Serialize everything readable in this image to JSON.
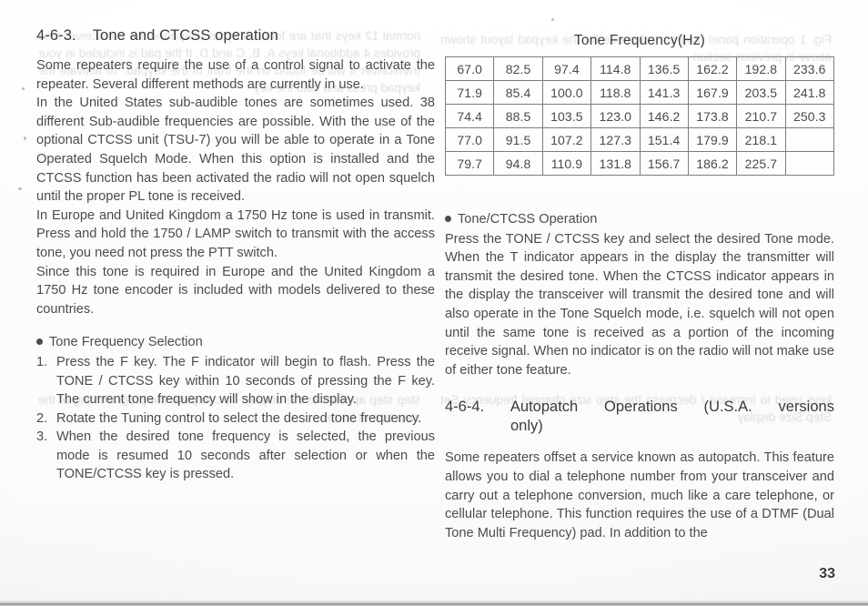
{
  "page": {
    "number": "33"
  },
  "left_column": {
    "heading": {
      "number": "4-6-3.",
      "title": "Tone and CTCSS operation"
    },
    "paragraphs": [
      "Some repeaters require the use of a control signal to activate the repeater. Several different methods are currently in use.",
      "In the United States sub-audible tones are sometimes used. 38 different Sub-audible frequencies are possible. With the use of the optional CTCSS unit (TSU-7) you will be able to operate in a Tone Operated Squelch Mode. When this option is installed and the CTCSS function has been activated the radio will not open squelch until the proper PL tone is received.",
      "In Europe and United Kingdom a 1750 Hz tone is used in transmit. Press and hold the 1750 / LAMP switch to transmit with the access tone, you need not press the PTT switch.",
      "Since this tone is required in Europe and the United Kingdom a 1750 Hz tone encoder is included with models delivered to these countries."
    ],
    "bullet_heading": "Tone Frequency Selection",
    "steps": [
      {
        "marker": "1.",
        "text": "Press the F key. The F indicator will begin to flash. Press the TONE / CTCSS key within 10 seconds of pressing the F key. The current tone frequency will show in the display."
      },
      {
        "marker": "2.",
        "text": "Rotate the Tuning control to select the desired tone frequency."
      },
      {
        "marker": "3.",
        "text": "When the desired tone frequency is selected, the previous mode is resumed 10 seconds after selection or when the TONE/CTCSS key is pressed."
      }
    ]
  },
  "right_column": {
    "table": {
      "title": "Tone Frequency(Hz)",
      "rows": [
        [
          "67.0",
          "82.5",
          "97.4",
          "114.8",
          "136.5",
          "162.2",
          "192.8",
          "233.6"
        ],
        [
          "71.9",
          "85.4",
          "100.0",
          "118.8",
          "141.3",
          "167.9",
          "203.5",
          "241.8"
        ],
        [
          "74.4",
          "88.5",
          "103.5",
          "123.0",
          "146.2",
          "173.8",
          "210.7",
          "250.3"
        ],
        [
          "77.0",
          "91.5",
          "107.2",
          "127.3",
          "151.4",
          "179.9",
          "218.1",
          ""
        ],
        [
          "79.7",
          "94.8",
          "110.9",
          "131.8",
          "156.7",
          "186.2",
          "225.7",
          ""
        ]
      ]
    },
    "bullet_heading": "Tone/CTCSS Operation",
    "paragraph_1": "Press the TONE / CTCSS key and select the desired Tone mode. When the T indicator appears in the display the transmitter will transmit the desired tone. When the CTCSS indicator appears in the display the transceiver will transmit the desired tone and will also operate in the Tone Squelch mode, i.e. squelch will not open until the same tone is received as a portion of the incoming receive signal. When no indicator is on the radio will not make use of either tone feature.",
    "heading_2": {
      "number": "4-6-4.",
      "word_1": "Autopatch",
      "word_2": "Operations",
      "word_3": "(U.S.A.",
      "word_4": "versions",
      "line_2": "only)"
    },
    "paragraph_2": "Some repeaters offset a service known as autopatch. This feature allows you to dial a telephone number from your transceiver and carry out a telephone conversion, much like a care telephone, or cellular telephone. This function requires the use of a DTMF (Dual Tone Multi Frequency) pad. In addition to the"
  },
  "ghost_text": {
    "block_a": "Fig. 1 operation panel diagram reference for the keypad layout shown above in previous section",
    "block_b": "normal 12 keys that are found on your telephone the transceiver also provides 4 additional keys A, B, C and D. If the pad is included in your transceiver it will be found on the front of the keypad. To activate the keypad press and hold the key",
    "block_c": "keys used to increase / decrease the step size channel frequency Set Step Size display",
    "block_d": "step step appears in the display. To complete the programming of the step size at home."
  }
}
